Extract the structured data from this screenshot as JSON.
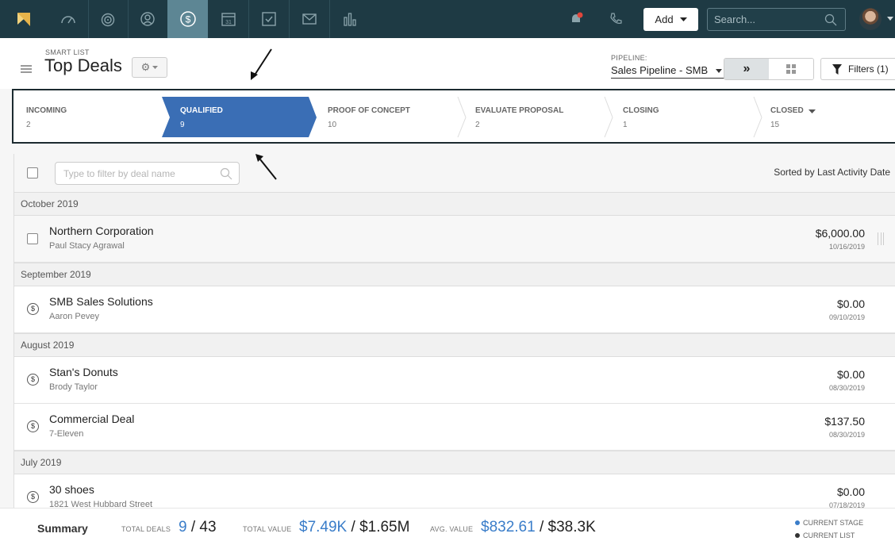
{
  "nav": {
    "items": [
      "dashboard",
      "leads",
      "contacts",
      "deals",
      "calendar",
      "tasks",
      "mail",
      "reports"
    ],
    "add_label": "Add",
    "search_placeholder": "Search..."
  },
  "header": {
    "smart_list_label": "SMART LIST",
    "title": "Top Deals",
    "pipeline_label": "PIPELINE:",
    "pipeline_value": "Sales Pipeline - SMB",
    "filters_label": "Filters (1)"
  },
  "stages": [
    {
      "name": "INCOMING",
      "count": "2"
    },
    {
      "name": "QUALIFIED",
      "count": "9"
    },
    {
      "name": "PROOF OF CONCEPT",
      "count": "10"
    },
    {
      "name": "EVALUATE PROPOSAL",
      "count": "2"
    },
    {
      "name": "CLOSING",
      "count": "1"
    },
    {
      "name": "CLOSED",
      "count": "15"
    }
  ],
  "list": {
    "filter_placeholder": "Type to filter by deal name",
    "sorted_label": "Sorted by Last Activity Date",
    "groups": [
      {
        "label": "October 2019",
        "deals": [
          {
            "title": "Northern Corporation",
            "contact": "Paul Stacy Agrawal",
            "value": "$6,000.00",
            "date": "10/16/2019"
          }
        ]
      },
      {
        "label": "September 2019",
        "deals": [
          {
            "title": "SMB Sales Solutions",
            "contact": "Aaron Pevey",
            "value": "$0.00",
            "date": "09/10/2019"
          }
        ]
      },
      {
        "label": "August 2019",
        "deals": [
          {
            "title": "Stan's Donuts",
            "contact": "Brody Taylor",
            "value": "$0.00",
            "date": "08/30/2019"
          },
          {
            "title": "Commercial Deal",
            "contact": "7-Eleven",
            "value": "$137.50",
            "date": "08/30/2019"
          }
        ]
      },
      {
        "label": "July 2019",
        "deals": [
          {
            "title": "30 shoes",
            "contact": "1821 West Hubbard Street",
            "value": "$0.00",
            "date": "07/18/2019"
          }
        ]
      }
    ]
  },
  "summary": {
    "title": "Summary",
    "total_deals_label": "TOTAL DEALS",
    "total_deals_current": "9",
    "total_deals_all": "/ 43",
    "total_value_label": "TOTAL VALUE",
    "total_value_current": "$7.49K",
    "total_value_all": "/ $1.65M",
    "avg_value_label": "AVG. VALUE",
    "avg_value_current": "$832.61",
    "avg_value_all": "/ $38.3K",
    "legend_current_stage": "CURRENT STAGE",
    "legend_current_list": "CURRENT LIST"
  },
  "colors": {
    "topbar": "#1e3a44",
    "active_stage": "#3a6eb5",
    "accent": "#3a7dc9"
  }
}
